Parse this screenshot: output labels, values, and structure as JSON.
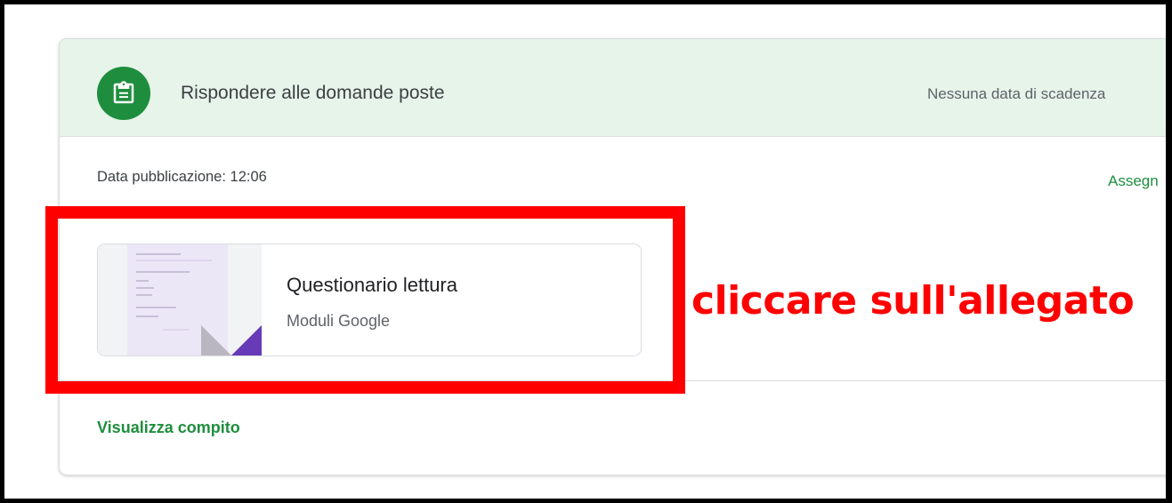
{
  "assignment": {
    "title": "Rispondere alle domande poste",
    "due": "Nessuna data di scadenza",
    "published": "Data pubblicazione: 12:06",
    "status": "Assegn",
    "icon": "assignment-icon"
  },
  "attachment": {
    "title": "Questionario lettura",
    "type": "Moduli Google",
    "thumbnail_icon": "google-forms-icon"
  },
  "footer": {
    "view_link": "Visualizza compito"
  },
  "annotation": {
    "text": "cliccare sull'allegato"
  },
  "colors": {
    "accent": "#1e8e3e",
    "header_bg": "#e6f4ea",
    "annotation": "#ff0000",
    "forms_purple": "#673ab7"
  }
}
